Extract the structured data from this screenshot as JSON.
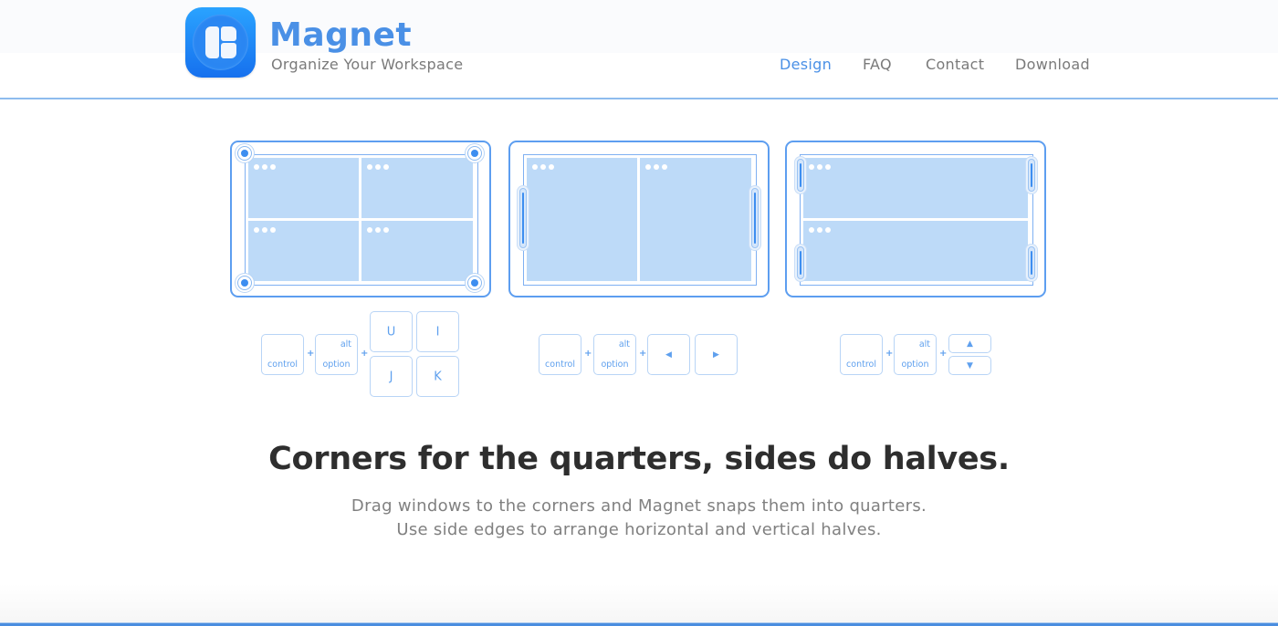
{
  "header": {
    "brand": "Magnet",
    "tagline": "Organize Your Workspace",
    "logo_icon": "magnet-app-icon",
    "nav": [
      {
        "label": "Design",
        "active": true
      },
      {
        "label": "FAQ",
        "active": false
      },
      {
        "label": "Contact",
        "active": false
      },
      {
        "label": "Download",
        "active": false
      }
    ]
  },
  "colors": {
    "accent": "#4a90e6",
    "panel_border": "#5d9ef0",
    "window_fill": "#bddaf8",
    "handle": "#3d8ef0",
    "headline": "#2e2e2e",
    "body_text": "#808080"
  },
  "illustrations": [
    {
      "name": "quarters",
      "handles": "corners",
      "windows": 4
    },
    {
      "name": "vertical-halves",
      "handles": "left-right-edges",
      "windows": 2
    },
    {
      "name": "horizontal-halves",
      "handles": "left-right-edges-top-bottom",
      "windows": 2
    }
  ],
  "shortcuts": {
    "quarters": {
      "control": "control",
      "alt": "alt",
      "option": "option",
      "plus": "+",
      "keys": [
        "U",
        "I",
        "J",
        "K"
      ]
    },
    "vertical": {
      "control": "control",
      "alt": "alt",
      "option": "option",
      "plus": "+",
      "keys": [
        "◀",
        "▶"
      ]
    },
    "horizontal": {
      "control": "control",
      "alt": "alt",
      "option": "option",
      "plus": "+",
      "keys": [
        "▲",
        "▼"
      ]
    }
  },
  "main": {
    "headline": "Corners for the quarters, sides do halves.",
    "description": [
      "Drag windows to the corners and Magnet snaps them into quarters.",
      "Use side edges to arrange horizontal and vertical halves."
    ]
  }
}
